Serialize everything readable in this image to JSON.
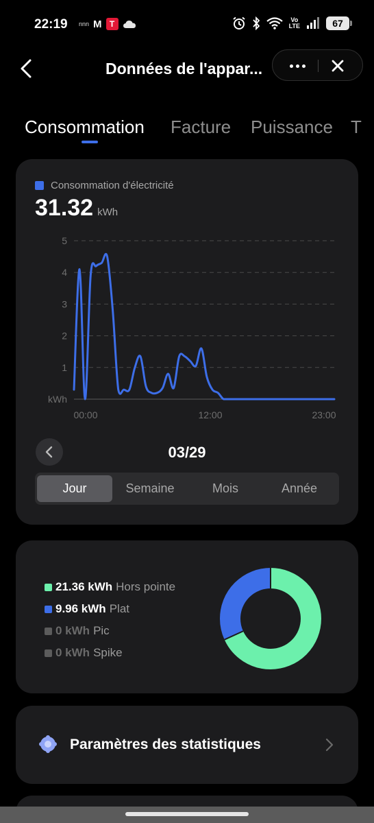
{
  "status_bar": {
    "time": "22:19",
    "mini_text": "nnn",
    "mail_letter": "M",
    "tesla_letter": "T",
    "volte": [
      "Vo",
      "LTE"
    ],
    "battery": "67",
    "icons": [
      "cloud-icon",
      "alarm-icon",
      "bluetooth-icon",
      "wifi-icon",
      "signal-icon"
    ]
  },
  "header": {
    "title": "Données de l'appar..."
  },
  "tabs": [
    {
      "label": "Consommation",
      "active": true
    },
    {
      "label": "Facture",
      "active": false
    },
    {
      "label": "Puissance",
      "active": false
    },
    {
      "label": "T",
      "active": false
    }
  ],
  "consumption": {
    "legend_label": "Consommation d'électricité",
    "total_value": "31.32",
    "total_unit": "kWh",
    "date": "03/29",
    "periods": [
      {
        "label": "Jour",
        "active": true
      },
      {
        "label": "Semaine",
        "active": false
      },
      {
        "label": "Mois",
        "active": false
      },
      {
        "label": "Année",
        "active": false
      }
    ]
  },
  "chart_data": {
    "type": "line",
    "x": [
      0,
      1,
      2,
      3,
      4,
      5,
      6,
      7,
      8,
      9,
      10,
      11,
      12,
      13,
      14,
      15,
      16,
      17,
      18,
      19,
      20,
      21,
      22,
      23,
      24,
      25,
      26,
      27,
      28,
      29,
      30,
      31,
      32,
      33,
      34,
      35,
      36,
      37,
      38,
      39,
      40,
      41,
      42,
      43,
      44,
      45,
      46,
      47
    ],
    "series": [
      {
        "values": [
          0.3,
          4.1,
          0.0,
          3.9,
          4.2,
          4.3,
          4.5,
          2.8,
          0.3,
          0.3,
          0.3,
          1.0,
          1.35,
          0.4,
          0.2,
          0.2,
          0.35,
          0.8,
          0.35,
          1.35,
          1.35,
          1.2,
          1.05,
          1.6,
          0.7,
          0.3,
          0.2,
          0.0,
          0.0,
          0.0,
          0.0,
          0.0,
          0.0,
          0.0,
          0.0,
          0.0,
          0.0,
          0.0,
          0.0,
          0.0,
          0.0,
          0.0,
          0.0,
          0.0,
          0.0,
          0.0,
          0.0,
          0.0
        ],
        "color": "#3d6ee8"
      }
    ],
    "ylabel": "kWh",
    "ylim": [
      0,
      5
    ],
    "yticks": [
      "1",
      "2",
      "3",
      "4",
      "5"
    ],
    "xtick_labels": [
      "00:00",
      "12:00",
      "23:00"
    ],
    "grid": true,
    "legend": "top-left"
  },
  "breakdown": {
    "items": [
      {
        "value": "21.36 kWh",
        "label": "Hors pointe",
        "color": "#6cf0ac",
        "active": true,
        "share": 0.682
      },
      {
        "value": "9.96 kWh",
        "label": "Plat",
        "color": "#3d6ee8",
        "active": true,
        "share": 0.318
      },
      {
        "value": "0 kWh",
        "label": "Pic",
        "color": "#5c5c5c",
        "active": false,
        "share": 0
      },
      {
        "value": "0 kWh",
        "label": "Spike",
        "color": "#5c5c5c",
        "active": false,
        "share": 0
      }
    ]
  },
  "settings": {
    "label": "Paramètres des statistiques"
  }
}
